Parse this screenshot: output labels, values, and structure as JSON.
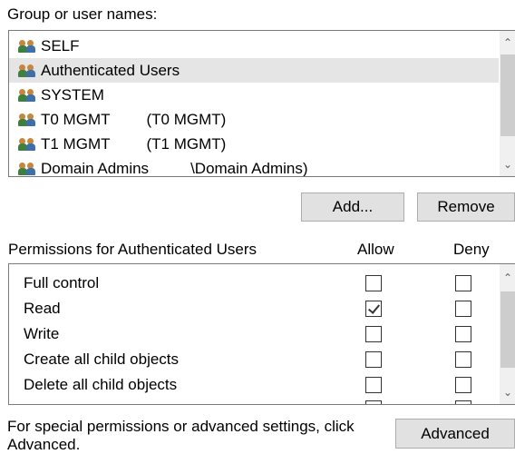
{
  "group_label": "Group or user names:",
  "users": [
    {
      "name": "SELF",
      "extra": ""
    },
    {
      "name": "Authenticated Users",
      "extra": "",
      "selected": true
    },
    {
      "name": "SYSTEM",
      "extra": ""
    },
    {
      "name": "T0 MGMT",
      "extra": "(T0 MGMT)"
    },
    {
      "name": "T1 MGMT",
      "extra": "(T1 MGMT)"
    },
    {
      "name": "Domain Admins",
      "extra": "\\Domain Admins)"
    }
  ],
  "buttons": {
    "add": "Add...",
    "remove": "Remove",
    "advanced": "Advanced"
  },
  "permissions": {
    "header": "Permissions for Authenticated Users",
    "allow_label": "Allow",
    "deny_label": "Deny",
    "rows": [
      {
        "name": "Full control",
        "allow": false,
        "deny": false
      },
      {
        "name": "Read",
        "allow": true,
        "deny": false
      },
      {
        "name": "Write",
        "allow": false,
        "deny": false
      },
      {
        "name": "Create all child objects",
        "allow": false,
        "deny": false
      },
      {
        "name": "Delete all child objects",
        "allow": false,
        "deny": false
      }
    ]
  },
  "footer_text_line1": "For special permissions or advanced settings, click",
  "footer_text_line2": "Advanced."
}
